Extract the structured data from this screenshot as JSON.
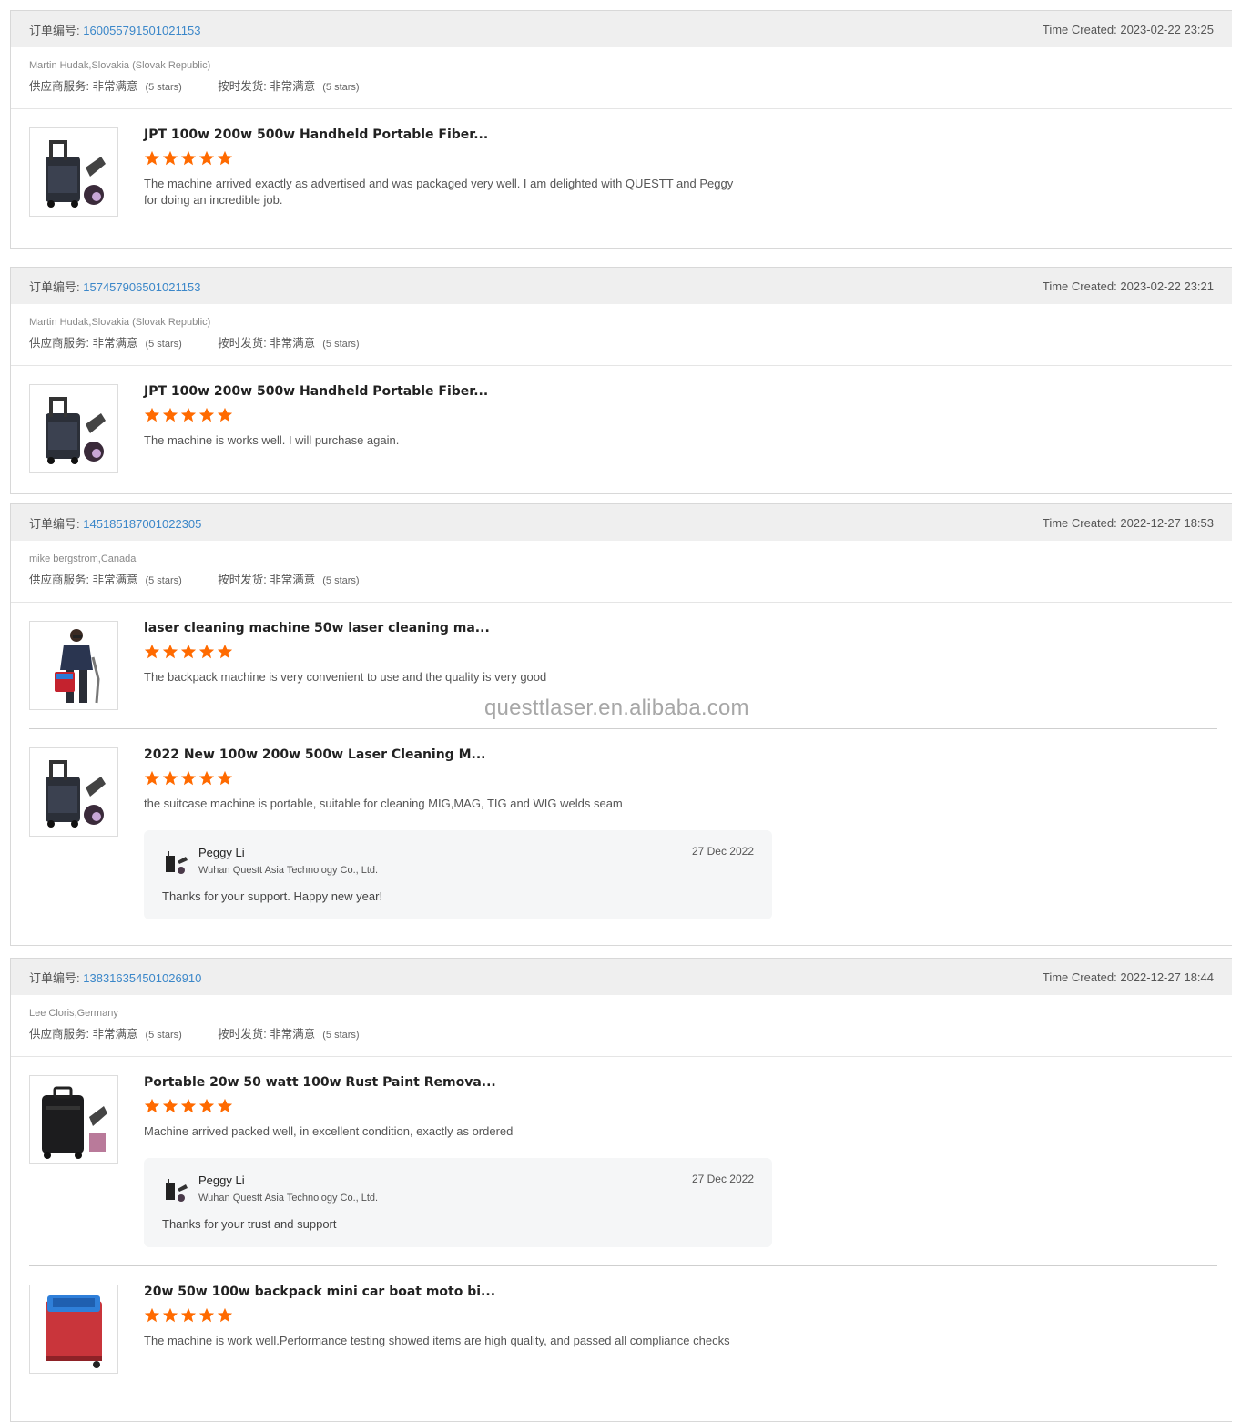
{
  "orders": [
    {
      "order_label": "订单编号:",
      "order_no": "160055791501021153",
      "time_created": "Time Created: 2023-02-22 23:25",
      "buyer": "Martin Hudak,Slovakia (Slovak Republic)",
      "supplier_service": "供应商服务: 非常满意",
      "supplier_stars": "(5 stars)",
      "on_time": "按时发货: 非常满意",
      "on_time_stars": "(5 stars)",
      "items": [
        {
          "title": "JPT 100w 200w 500w Handheld Portable Fiber...",
          "rating": 5,
          "review": "The machine arrived exactly as advertised and was packaged very well. I am delighted with QUESTT and Peggy for doing an incredible job."
        }
      ]
    },
    {
      "order_label": "订单编号:",
      "order_no": "157457906501021153",
      "time_created": "Time Created: 2023-02-22 23:21",
      "buyer": "Martin Hudak,Slovakia (Slovak Republic)",
      "supplier_service": "供应商服务: 非常满意",
      "supplier_stars": "(5 stars)",
      "on_time": "按时发货: 非常满意",
      "on_time_stars": "(5 stars)",
      "items": [
        {
          "title": "JPT 100w 200w 500w Handheld Portable Fiber...",
          "rating": 5,
          "review": "The machine is works well. I will purchase again."
        }
      ]
    },
    {
      "order_label": "订单编号:",
      "order_no": "145185187001022305",
      "time_created": "Time Created: 2022-12-27 18:53",
      "buyer": "mike bergstrom,Canada",
      "supplier_service": "供应商服务: 非常满意",
      "supplier_stars": "(5 stars)",
      "on_time": "按时发货: 非常满意",
      "on_time_stars": "(5 stars)",
      "items": [
        {
          "title": "laser cleaning machine 50w laser cleaning ma...",
          "rating": 5,
          "review": "The backpack machine is very convenient to use and the quality is very good"
        },
        {
          "title": "2022 New 100w 200w 500w Laser Cleaning M...",
          "rating": 5,
          "review": "the suitcase machine is portable, suitable for cleaning MIG,MAG, TIG and WIG welds seam",
          "reply": {
            "name": "Peggy Li",
            "company": "Wuhan Questt Asia Technology Co., Ltd.",
            "date": "27 Dec 2022",
            "text": "Thanks for your support. Happy new year!"
          }
        }
      ]
    },
    {
      "order_label": "订单编号:",
      "order_no": "138316354501026910",
      "time_created": "Time Created: 2022-12-27 18:44",
      "buyer": "Lee Cloris,Germany",
      "supplier_service": "供应商服务: 非常满意",
      "supplier_stars": "(5 stars)",
      "on_time": "按时发货: 非常满意",
      "on_time_stars": "(5 stars)",
      "items": [
        {
          "title": "Portable 20w 50 watt 100w Rust Paint Remova...",
          "rating": 5,
          "review": "Machine arrived packed well, in excellent condition, exactly as ordered",
          "reply": {
            "name": "Peggy Li",
            "company": "Wuhan Questt Asia Technology Co., Ltd.",
            "date": "27 Dec 2022",
            "text": "Thanks for your trust and support"
          }
        },
        {
          "title": "20w 50w 100w backpack mini car boat moto bi...",
          "rating": 5,
          "review": "The machine is work well.Performance testing showed items are high quality, and passed all compliance checks"
        }
      ]
    }
  ],
  "watermark": "questtlaser.en.alibaba.com",
  "colors": {
    "star": "#ff6a00",
    "link": "#3b87c9",
    "header_bg": "#efefef"
  }
}
